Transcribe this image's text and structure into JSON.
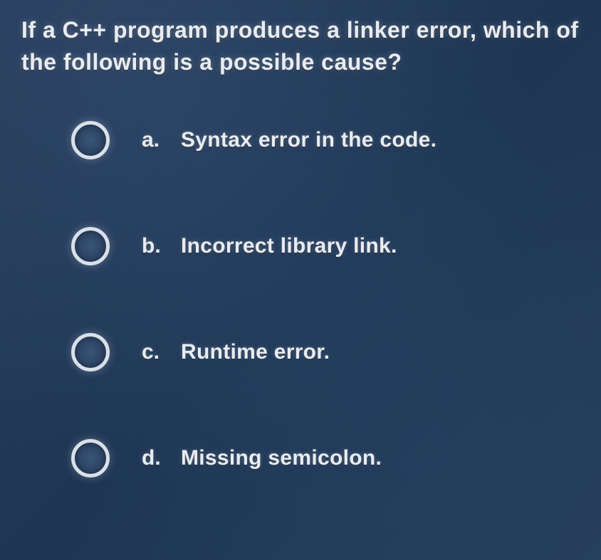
{
  "question": "If a C++ program produces a linker error, which of the following is a possible cause?",
  "options": [
    {
      "label": "a.",
      "text": "Syntax error in the code."
    },
    {
      "label": "b.",
      "text": "Incorrect library link."
    },
    {
      "label": "c.",
      "text": "Runtime error."
    },
    {
      "label": "d.",
      "text": "Missing semicolon."
    }
  ]
}
